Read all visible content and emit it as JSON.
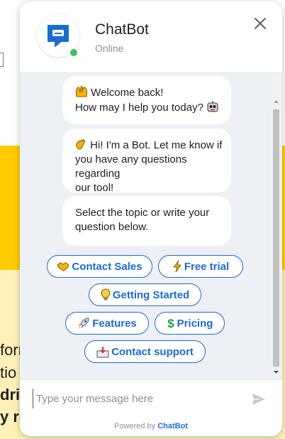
{
  "background_page": {
    "lines": [
      "forr",
      "tio",
      "driv",
      "y re"
    ]
  },
  "header": {
    "bot_name": "ChatBot",
    "status": "Online"
  },
  "messages": [
    {
      "icon": "raised-hands-icon",
      "lines": [
        "Welcome back!",
        "How may I help you today?"
      ],
      "trailing_icon": "robot-face-icon"
    },
    {
      "icon": "waving-hand-icon",
      "lines": [
        "Hi! I'm a Bot. Let me know if",
        "you have any questions regarding",
        "our tool!"
      ]
    },
    {
      "lines": [
        "Select the topic or write your",
        "question below."
      ]
    }
  ],
  "quick_replies": [
    {
      "label": "Contact Sales",
      "icon": "handshake-icon"
    },
    {
      "label": "Free trial",
      "icon": "lightning-icon"
    },
    {
      "label": "Getting Started",
      "icon": "lightbulb-icon"
    },
    {
      "label": "Features",
      "icon": "rocket-icon"
    },
    {
      "label": "Pricing",
      "icon": "dollar-icon"
    },
    {
      "label": "Contact support",
      "icon": "inbox-tray-icon"
    }
  ],
  "composer": {
    "placeholder": "Type your message here"
  },
  "footer": {
    "prefix": "Powered by",
    "brand": "ChatBot"
  },
  "colors": {
    "accent": "#1a6cd1",
    "online": "#3ec15c",
    "chat_bg": "#edf0f5",
    "page_yellow": "#ffcc00"
  }
}
